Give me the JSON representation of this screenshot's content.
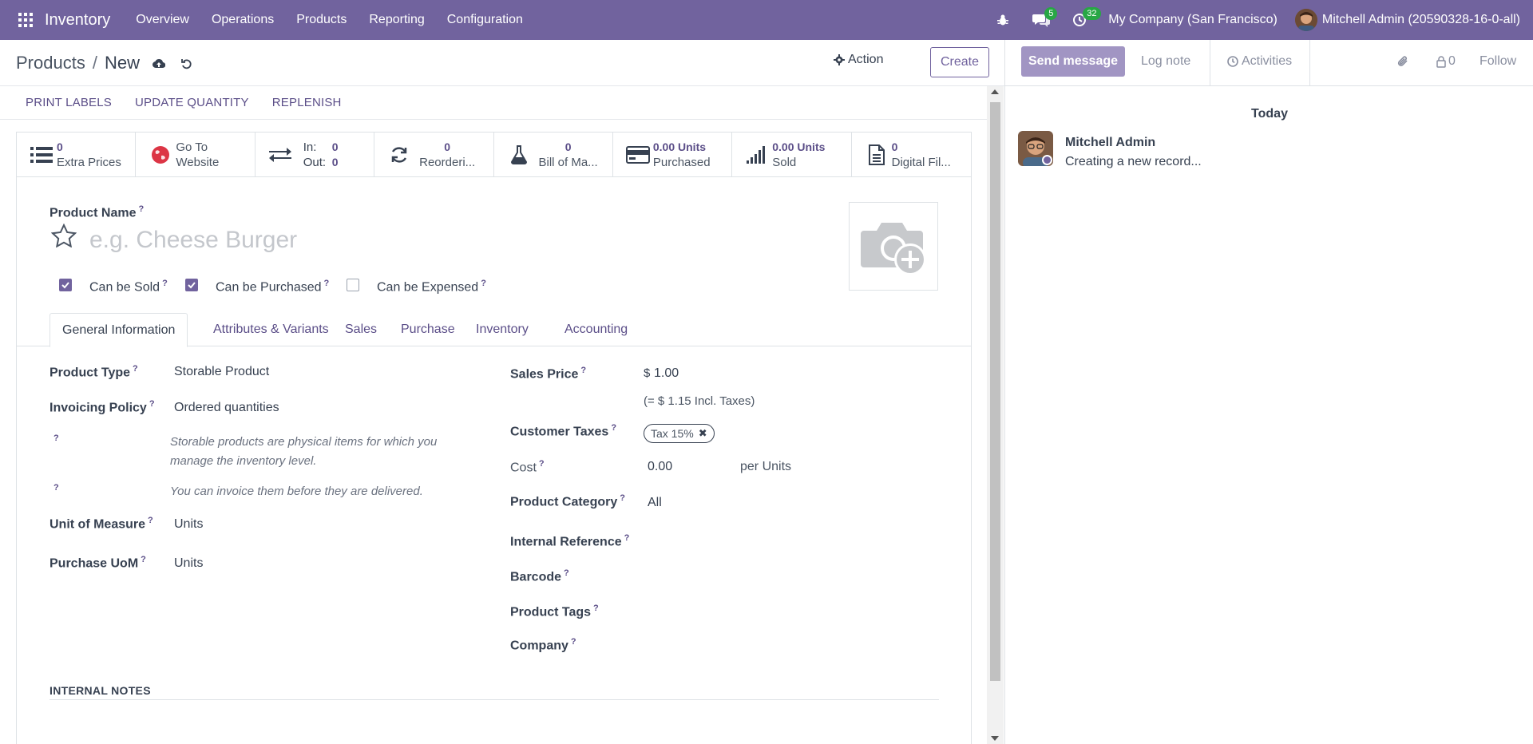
{
  "navbar": {
    "app_name": "Inventory",
    "menus": [
      "Overview",
      "Operations",
      "Products",
      "Reporting",
      "Configuration"
    ],
    "messages_badge": "5",
    "activities_badge": "32",
    "company": "My Company (San Francisco)",
    "user": "Mitchell Admin (20590328-16-0-all)",
    "bg_color": "#71639e"
  },
  "control": {
    "breadcrumb_parent": "Products",
    "breadcrumb_sep": "/",
    "breadcrumb_current": "New",
    "action_label": "Action",
    "create_label": "Create"
  },
  "header_buttons": [
    "PRINT LABELS",
    "UPDATE QUANTITY",
    "REPLENISH"
  ],
  "smart_buttons": {
    "extra_prices": {
      "value": "0",
      "label": "Extra Prices"
    },
    "website": {
      "line1": "Go To",
      "line2": "Website"
    },
    "inout": {
      "in_label": "In:",
      "in_value": "0",
      "out_label": "Out:",
      "out_value": "0"
    },
    "reordering": {
      "value": "0",
      "label": "Reorderi..."
    },
    "bom": {
      "value": "0",
      "label": "Bill of Ma..."
    },
    "purchased": {
      "value": "0.00 Units",
      "label": "Purchased"
    },
    "sold": {
      "value": "0.00 Units",
      "label": "Sold"
    },
    "digital": {
      "value": "0",
      "label": "Digital Fil..."
    }
  },
  "form": {
    "product_name_label": "Product Name",
    "product_name_placeholder": "e.g. Cheese Burger",
    "can_be_sold": {
      "label": "Can be Sold",
      "checked": true
    },
    "can_be_purchased": {
      "label": "Can be Purchased",
      "checked": true
    },
    "can_be_expensed": {
      "label": "Can be Expensed",
      "checked": false
    },
    "help_mark": "?",
    "tabs": [
      "General Information",
      "Attributes & Variants",
      "Sales",
      "Purchase",
      "Inventory",
      "Accounting"
    ],
    "active_tab": "General Information",
    "product_type": {
      "label": "Product Type",
      "value": "Storable Product"
    },
    "invoicing_policy": {
      "label": "Invoicing Policy",
      "value": "Ordered quantities"
    },
    "hint1_line1": "Storable products are physical items for which you",
    "hint1_line2": "manage the inventory level.",
    "hint2": "You can invoice them before they are delivered.",
    "uom": {
      "label": "Unit of Measure",
      "value": "Units"
    },
    "purchase_uom": {
      "label": "Purchase UoM",
      "value": "Units"
    },
    "sales_price": {
      "label": "Sales Price",
      "currency": "$",
      "value": "1.00",
      "incl_taxes": "(= $ 1.15 Incl. Taxes)"
    },
    "customer_taxes": {
      "label": "Customer Taxes",
      "tag": "Tax 15%"
    },
    "cost": {
      "label": "Cost",
      "value": "0.00",
      "per": "per Units"
    },
    "product_category": {
      "label": "Product Category",
      "value": "All"
    },
    "internal_reference": {
      "label": "Internal Reference"
    },
    "barcode": {
      "label": "Barcode"
    },
    "product_tags": {
      "label": "Product Tags"
    },
    "company": {
      "label": "Company"
    },
    "internal_notes_label": "INTERNAL NOTES"
  },
  "chatter": {
    "send_message": "Send message",
    "log_note": "Log note",
    "activities": "Activities",
    "followers_count": "0",
    "follow": "Follow",
    "date_separator": "Today",
    "author": "Mitchell Admin",
    "message": "Creating a new record..."
  }
}
